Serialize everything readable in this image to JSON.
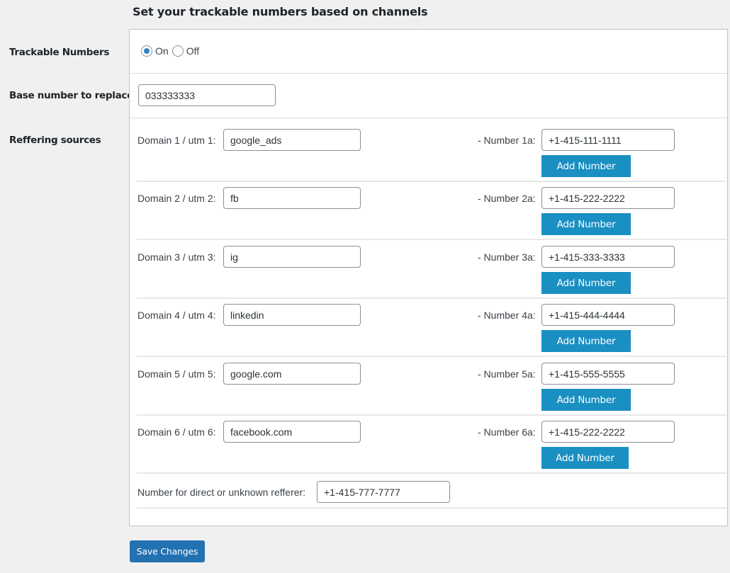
{
  "page": {
    "title": "Set your trackable numbers based on channels"
  },
  "trackable_numbers": {
    "label": "Trackable Numbers",
    "options": [
      {
        "label": "On",
        "checked": true
      },
      {
        "label": "Off",
        "checked": false
      }
    ]
  },
  "base_number": {
    "label": "Base number to replace",
    "value": "033333333"
  },
  "referring_sources": {
    "label": "Reffering sources",
    "add_button_label": "Add Number",
    "rows": [
      {
        "domain_label": "Domain 1 / utm 1:",
        "domain_value": "google_ads",
        "number_label": "- Number 1a:",
        "number_value": "+1-415-111-1111"
      },
      {
        "domain_label": "Domain 2 / utm 2:",
        "domain_value": "fb",
        "number_label": "- Number 2a:",
        "number_value": "+1-415-222-2222"
      },
      {
        "domain_label": "Domain 3 / utm 3:",
        "domain_value": "ig",
        "number_label": "- Number 3a:",
        "number_value": "+1-415-333-3333"
      },
      {
        "domain_label": "Domain 4 / utm 4:",
        "domain_value": "linkedin",
        "number_label": "- Number 4a:",
        "number_value": "+1-415-444-4444"
      },
      {
        "domain_label": "Domain 5 / utm 5:",
        "domain_value": "google.com",
        "number_label": "- Number 5a:",
        "number_value": "+1-415-555-5555"
      },
      {
        "domain_label": "Domain 6 / utm 6:",
        "domain_value": "facebook.com",
        "number_label": "- Number 6a:",
        "number_value": "+1-415-222-2222"
      }
    ],
    "direct_label": "Number for direct or unknown refferer:",
    "direct_value": "+1-415-777-7777"
  },
  "footer": {
    "save_label": "Save Changes"
  },
  "colors": {
    "primary_button": "#2271b1",
    "add_button": "#1a8fc2",
    "radio_checked": "#3582c4",
    "background": "#f0f0f1"
  }
}
